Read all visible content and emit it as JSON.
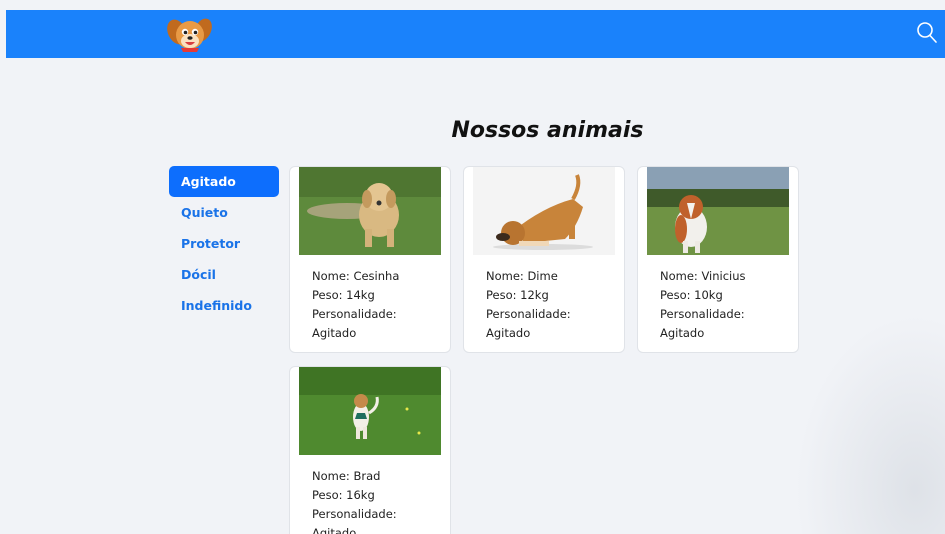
{
  "header": {
    "logo_icon": "puppy-logo",
    "search_icon": "search-icon",
    "bg_color": "#1a82fb"
  },
  "main": {
    "title": "Nossos animais"
  },
  "sidebar": {
    "items": [
      {
        "label": "Agitado",
        "active": true
      },
      {
        "label": "Quieto"
      },
      {
        "label": "Protetor"
      },
      {
        "label": "Dócil"
      },
      {
        "label": "Indefinido"
      }
    ]
  },
  "animals": [
    {
      "nome": "Nome: Cesinha",
      "peso": "Peso: 14kg",
      "personalidade_label": "Personalidade:",
      "personalidade": "Agitado",
      "photo": "golden-puppy-running"
    },
    {
      "nome": "Nome: Dime",
      "peso": "Peso: 12kg",
      "personalidade_label": "Personalidade:",
      "personalidade": "Agitado",
      "photo": "dog-play-bow"
    },
    {
      "nome": "Nome: Vinicius",
      "peso": "Peso: 10kg",
      "personalidade_label": "Personalidade:",
      "personalidade": "Agitado",
      "photo": "collie-on-grass"
    },
    {
      "nome": "Nome: Brad",
      "peso": "Peso: 16kg",
      "personalidade_label": "Personalidade:",
      "personalidade": "Agitado",
      "photo": "small-dog-running"
    }
  ]
}
